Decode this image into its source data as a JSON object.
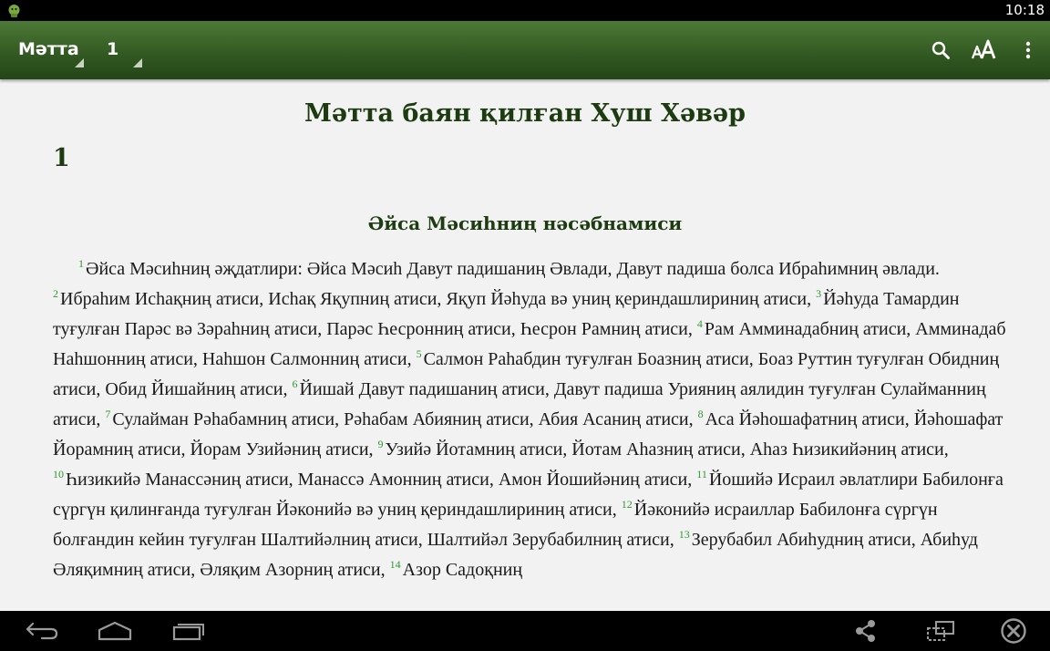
{
  "status_bar": {
    "time": "10:18"
  },
  "toolbar": {
    "book": "Мәтта",
    "chapter": "1",
    "icons": [
      "search-icon",
      "font-size-icon",
      "overflow-menu-icon"
    ]
  },
  "content": {
    "book_title": "Мәтта баян қилған Хуш Хәвәр",
    "chapter_number": "1",
    "section_heading": "Әйса Мәсиһниң нәсәбнамиси",
    "verses": [
      {
        "n": "1",
        "text": "Әйса Мәсиһниң әҗдатлири: Әйса Мәсиһ Давут падишаниң Әвлади, Давут падиша болса Ибраһимниң әвлади."
      },
      {
        "n": "2",
        "text": "Ибраһим Исһақниң атиси, Исһақ Яқупниң атиси, Яқуп Йәһуда вә униң қериндашлириниң атиси,"
      },
      {
        "n": "3",
        "text": "Йәһуда Тамардин туғулған Парәс вә Зәраһниң атиси, Парәс Һесронниң атиси, Һесрон Рамниң атиси,"
      },
      {
        "n": "4",
        "text": "Рам Амминадабниң атиси, Амминадаб Наһшонниң атиси, Наһшон Салмонниң атиси,"
      },
      {
        "n": "5",
        "text": "Салмон Раһабдин туғулған Боазниң атиси, Боаз Руттин туғулған Обидниң атиси, Обид Йишайниң атиси,"
      },
      {
        "n": "6",
        "text": "Йишай Давут падишаниң атиси, Давут падиша Урияниң аялидин туғулған Сулайманниң атиси,"
      },
      {
        "n": "7",
        "text": "Сулайман Рәһабамниң атиси, Рәһабам Абияниң атиси, Абия Асаниң атиси,"
      },
      {
        "n": "8",
        "text": "Аса Йәһошафатниң атиси, Йәһошафат Йорамниң атиси, Йорам Узийәниң атиси,"
      },
      {
        "n": "9",
        "text": "Узийә Йотамниң атиси, Йотам Аһазниң атиси, Аһаз Һизикийәниң атиси,"
      },
      {
        "n": "10",
        "text": "Һизикийә Манассәниң атиси, Манассә Амонниң атиси, Амон Йошийәниң атиси,"
      },
      {
        "n": "11",
        "text": "Йошийә Исраил әвлатлири Бабилонға сүргүн қилинғанда туғулған Йәконийә вә униң қериндашлириниң атиси,"
      },
      {
        "n": "12",
        "text": "Йәконийә исраиллар Бабилонға сүргүн болғандин кейин туғулған Шалтийәлниң атиси, Шалтийәл Зерубабилниң атиси,"
      },
      {
        "n": "13",
        "text": "Зерубабил Абиһудниң атиси, Абиһуд Әляқимниң атиси, Әляқим Азорниң атиси,"
      },
      {
        "n": "14",
        "text": "Азор Садоқниң"
      }
    ]
  },
  "nav_bar": {
    "icons": [
      "back-icon",
      "home-icon",
      "recent-apps-icon",
      "share-icon",
      "window-icon",
      "close-icon"
    ]
  }
}
